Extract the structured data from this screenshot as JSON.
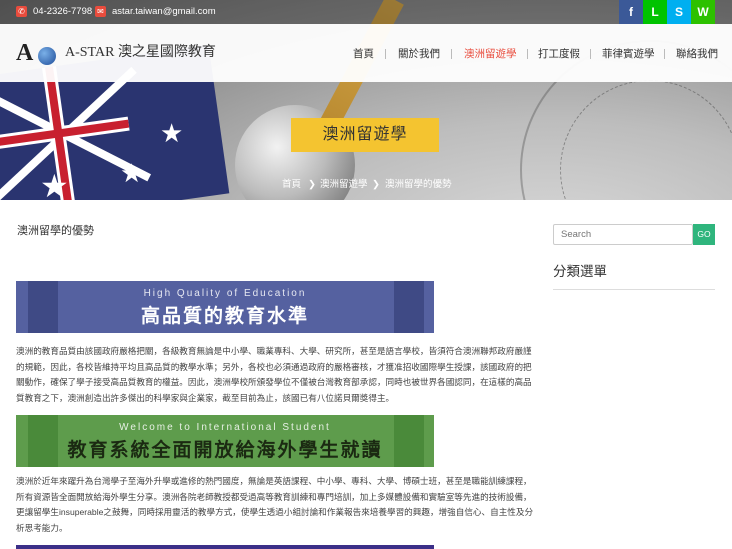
{
  "topbar": {
    "phone": "04-2326-7798",
    "email": "astar.taiwan@gmail.com",
    "social": [
      {
        "icon": "facebook-icon",
        "glyph": "f",
        "color": "#3b5998"
      },
      {
        "icon": "line-icon",
        "glyph": "L",
        "color": "#00c300"
      },
      {
        "icon": "skype-icon",
        "glyph": "S",
        "color": "#00aff0"
      },
      {
        "icon": "wechat-icon",
        "glyph": "W",
        "color": "#2dc100"
      }
    ]
  },
  "brand": {
    "name": "A-STAR 澳之星國際教育"
  },
  "nav": {
    "items": [
      "首頁",
      "關於我們",
      "澳洲留遊學",
      "打工度假",
      "菲律賓遊學",
      "聯絡我們"
    ],
    "active_index": 2
  },
  "hero": {
    "title": "澳洲留遊學",
    "breadcrumb": [
      "首頁",
      "澳洲留遊學",
      "澳洲留學的優勢"
    ]
  },
  "post": {
    "title": "澳洲留學的優勢",
    "banner1_sub": "High Quality of Education",
    "banner1_main": "高品質的教育水準",
    "para1": "澳洲的教育品質由該國政府嚴格把關，各級教育無論是中小學、職業專科、大學、研究所，甚至是語言學校，皆須符合澳洲聯邦政府嚴謹的規範，因此，各校皆維持平均且高品質的教學水準；另外，各校也必須通過政府的嚴格審核，才獲准招收國際學生授課，該國政府的把關動作，確保了學子接受高品質教育的權益。因此，澳洲學校所頒發學位不僅被台灣教育部承認，同時也被世界各國認同，在這樣的高品質教育之下，澳洲創造出許多傑出的科學家與企業家，截至目前為止，該國已有八位諾貝爾獎得主。",
    "banner2_sub": "Welcome to International Student",
    "banner2_main": "教育系統全面開放給海外學生就讀",
    "para2": "澳洲於近年來躍升為台灣學子至海外升學或進修的熱門國度，無論是英語課程、中小學、專科、大學、博碩士班，甚至是職能訓練課程，所有資源皆全面開放給海外學生分享。澳洲各院老師教授都受過高等教育訓練和專門培訓，加上多媒體設備和實驗室等先進的技術設備，更讓留學生insuperable之鼓舞，同時採用靈活的教學方式，使學生透過小組討論和作業報告來培養學習的興趣，增強自信心、自主性及分析思考能力。"
  },
  "sidebar": {
    "search_placeholder": "Search",
    "go_label": "GO",
    "category_title": "分類選單"
  }
}
